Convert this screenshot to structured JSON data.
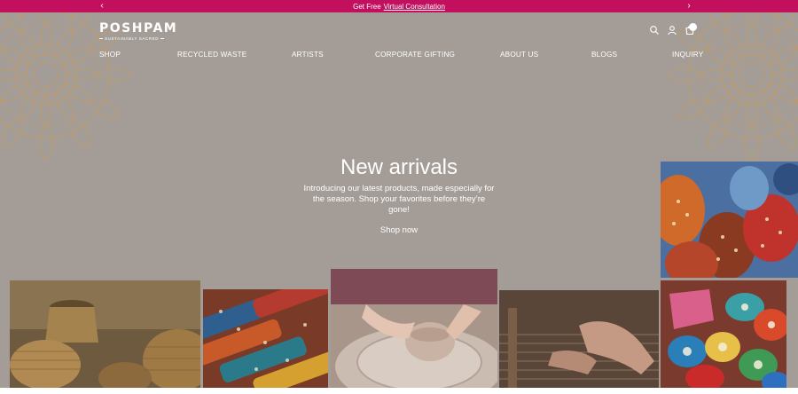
{
  "announcement": {
    "text": "Get Free",
    "link_text": "Virtual Consultation",
    "prev_icon": "chevron-left-icon",
    "next_icon": "chevron-right-icon"
  },
  "brand": {
    "name": "POSHPAM",
    "tagline": "SUSTAINABLY SACRED"
  },
  "header_icons": [
    "search-icon",
    "account-icon",
    "cart-icon"
  ],
  "nav": {
    "items": [
      {
        "label": "SHOP"
      },
      {
        "label": "RECYCLED WASTE"
      },
      {
        "label": "ARTISTS"
      },
      {
        "label": "CORPORATE GIFTING"
      },
      {
        "label": "ABOUT US"
      },
      {
        "label": "BLOGS"
      },
      {
        "label": "INQUIRY"
      }
    ]
  },
  "hero": {
    "title": "New arrivals",
    "description": "Introducing our latest products, made especially for the season. Shop your favorites before they’re gone!",
    "cta_label": "Shop now"
  },
  "tiles": [
    {
      "name": "wicker-baskets-image"
    },
    {
      "name": "painted-mosaic-trays-image"
    },
    {
      "name": "pottery-wheel-image"
    },
    {
      "name": "weaving-loom-image"
    },
    {
      "name": "painted-ornaments-image"
    },
    {
      "name": "painted-bowls-image"
    }
  ],
  "colors": {
    "announcement_bg": "#c2105f",
    "hero_overlay": "#a49d97",
    "text": "#ffffff",
    "mandala_gold": "#c79a5a"
  }
}
